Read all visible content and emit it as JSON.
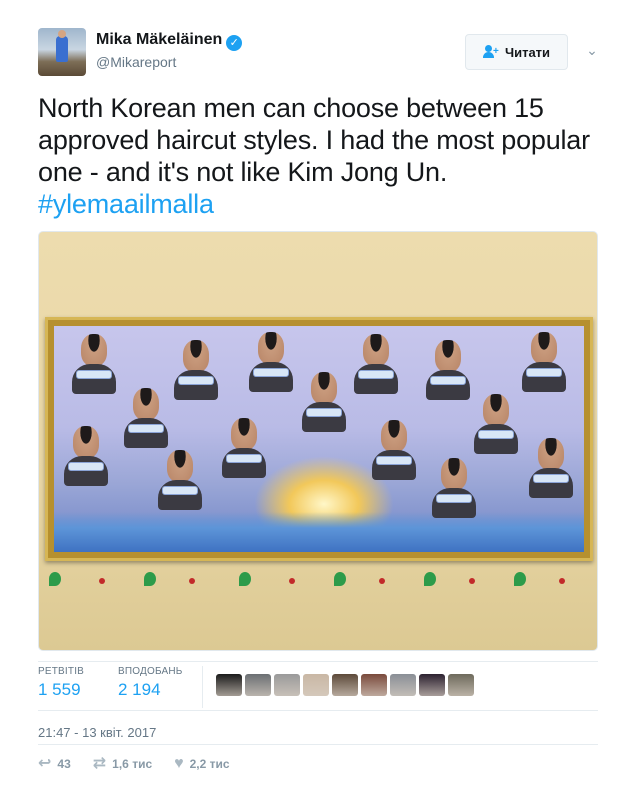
{
  "author": {
    "name": "Mika Mäkeläinen",
    "handle": "@Mikareport",
    "verified": true
  },
  "follow_button": {
    "label": "Читати",
    "icon": "follow-user-icon"
  },
  "menu": {
    "icon": "chevron-down-icon"
  },
  "tweet": {
    "text": "North Korean men can choose between 15 approved haircut styles. I had the most popular one - and it's not like Kim Jong Un.",
    "hashtag": "#ylemaailmalla"
  },
  "stats": {
    "retweets_label": "РЕТВІТІВ",
    "retweets_value": "1 559",
    "likes_label": "ВПОДОБАНЬ",
    "likes_value": "2 194"
  },
  "likers": [
    {
      "name": "liker-1",
      "color": "#1b1b1b"
    },
    {
      "name": "liker-2",
      "color": "#6b6f73"
    },
    {
      "name": "liker-3",
      "color": "#9a9a9a"
    },
    {
      "name": "liker-4",
      "color": "#c9b7a4"
    },
    {
      "name": "liker-5",
      "color": "#5d4a3a"
    },
    {
      "name": "liker-6",
      "color": "#7a4a3c"
    },
    {
      "name": "liker-7",
      "color": "#8a8f96"
    },
    {
      "name": "liker-8",
      "color": "#2c2130"
    },
    {
      "name": "liker-9",
      "color": "#6e6a5c"
    }
  ],
  "timestamp": "21:47 - 13 квіт. 2017",
  "actions": {
    "reply_count": "43",
    "retweet_count": "1,6 тис",
    "like_count": "2,2 тис"
  },
  "colors": {
    "accent": "#1da1f2",
    "muted": "#657786",
    "border": "#e6ecf0"
  }
}
